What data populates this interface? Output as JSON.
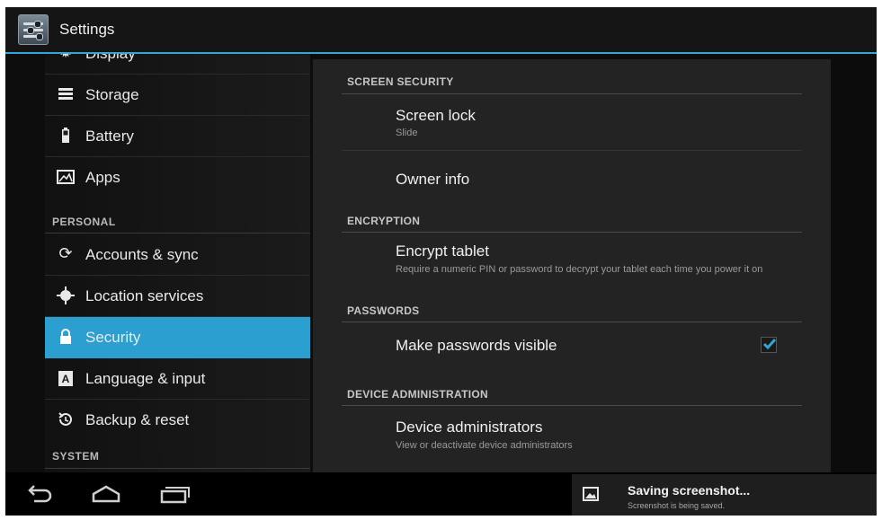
{
  "action_bar": {
    "title": "Settings",
    "icon": "settings-icon"
  },
  "sidebar": {
    "items": [
      {
        "label": "Display",
        "icon": "display-icon"
      },
      {
        "label": "Storage",
        "icon": "storage-icon"
      },
      {
        "label": "Battery",
        "icon": "battery-icon"
      },
      {
        "label": "Apps",
        "icon": "apps-icon"
      },
      {
        "label": "Accounts & sync",
        "icon": "sync-icon"
      },
      {
        "label": "Location services",
        "icon": "location-icon"
      },
      {
        "label": "Security",
        "icon": "lock-icon",
        "selected": true
      },
      {
        "label": "Language & input",
        "icon": "language-icon"
      },
      {
        "label": "Backup & reset",
        "icon": "backup-icon"
      }
    ],
    "headers": {
      "personal": "PERSONAL",
      "system": "SYSTEM"
    }
  },
  "content": {
    "screen_security": {
      "header": "SCREEN SECURITY",
      "screen_lock": {
        "title": "Screen lock",
        "summary": "Slide"
      },
      "owner_info": {
        "title": "Owner info"
      }
    },
    "encryption": {
      "header": "ENCRYPTION",
      "encrypt_tablet": {
        "title": "Encrypt tablet",
        "summary": "Require a numeric PIN or password to decrypt your tablet each time you power it on"
      }
    },
    "passwords": {
      "header": "PASSWORDS",
      "make_visible": {
        "title": "Make passwords visible",
        "checked": true
      }
    },
    "device_admin": {
      "header": "DEVICE ADMINISTRATION",
      "device_administrators": {
        "title": "Device administrators",
        "summary": "View or deactivate device administrators"
      }
    }
  },
  "nav_bar": {
    "buttons": [
      "back-icon",
      "home-icon",
      "recents-icon"
    ]
  },
  "notification": {
    "icon": "image-icon",
    "title": "Saving screenshot...",
    "text": "Screenshot is being saved."
  },
  "colors": {
    "accent": "#33a6d6",
    "selected": "#2a9fd0",
    "background": "#0c0c0c",
    "panel": "#232323"
  }
}
